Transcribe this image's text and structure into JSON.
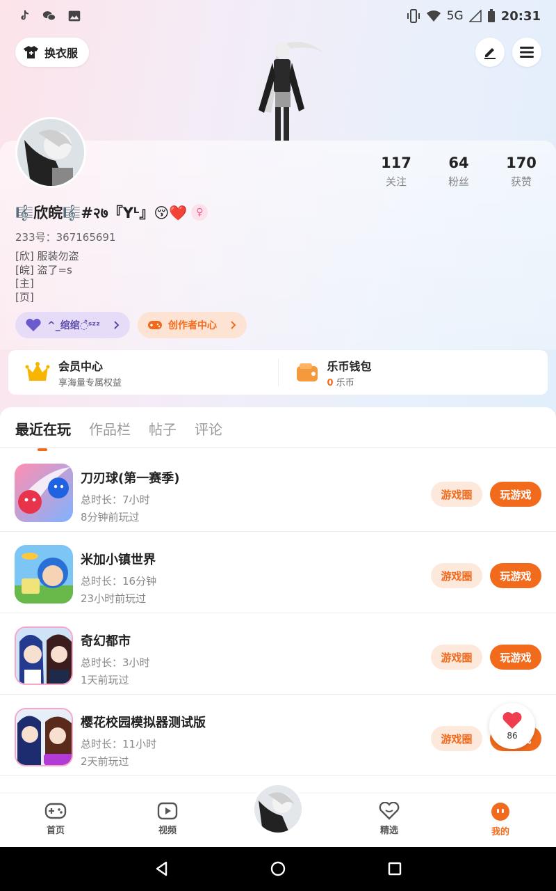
{
  "status_bar": {
    "time": "20:31",
    "network": "5G"
  },
  "header": {
    "outfit_button": "换衣服"
  },
  "profile": {
    "username": "🎼欣皖🎼#२७『Yᴸ』😚❤️",
    "uid": "233号：367165691",
    "bio": [
      "[欣]  服装勿盗",
      "[皖]  盗了=s",
      "[主]",
      "[页]"
    ],
    "stats": [
      {
        "value": "117",
        "label": "关注"
      },
      {
        "value": "64",
        "label": "粉丝"
      },
      {
        "value": "170",
        "label": "获赞"
      }
    ],
    "chips": {
      "fans_group": "^_绾绾◌̊ˢᶻᶻ",
      "creator_center": "创作者中心"
    }
  },
  "vip": {
    "member_title": "会员中心",
    "member_sub": "享海量专属权益",
    "wallet_title": "乐币钱包",
    "wallet_amount": "0",
    "wallet_unit": "乐币"
  },
  "tabs": [
    "最近在玩",
    "作品栏",
    "帖子",
    "评论"
  ],
  "games": [
    {
      "name": "刀刃球(第一赛季)",
      "duration": "总时长：7小时",
      "last_played": "8分钟前玩过"
    },
    {
      "name": "米加小镇世界",
      "duration": "总时长：16分钟",
      "last_played": "23小时前玩过"
    },
    {
      "name": "奇幻都市",
      "duration": "总时长：3小时",
      "last_played": "1天前玩过"
    },
    {
      "name": "樱花校园模拟器测试版",
      "duration": "总时长：11小时",
      "last_played": "2天前玩过"
    }
  ],
  "buttons": {
    "circle": "游戏圈",
    "play": "玩游戏"
  },
  "float_like": {
    "count": "86"
  },
  "bottom_nav": {
    "home": "首页",
    "video": "视频",
    "featured": "精选",
    "mine": "我的"
  },
  "colors": {
    "accent": "#f26b1d",
    "accent_light": "#fde8dc"
  }
}
